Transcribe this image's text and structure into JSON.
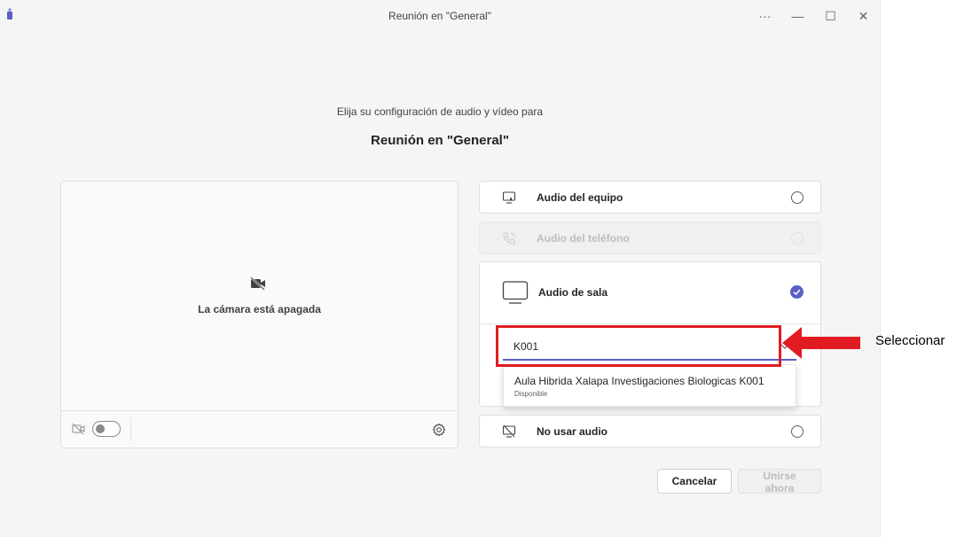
{
  "window": {
    "title": "Reunión en \"General\"",
    "more_label": "···",
    "minimize_label": "—",
    "maximize_label": "☐",
    "close_label": "✕"
  },
  "header": {
    "subtitle": "Elija su configuración de audio y vídeo para",
    "title": "Reunión en \"General\""
  },
  "video": {
    "camera_off_text": "La cámara está apagada",
    "camera_toggle_on": false
  },
  "audio_options": {
    "computer": {
      "label": "Audio del equipo",
      "selected": false
    },
    "phone": {
      "label": "Audio del teléfono",
      "disabled": true
    },
    "room": {
      "label": "Audio de sala",
      "selected": true,
      "search_value": "K001",
      "suggestion": {
        "name": "Aula Hibrida Xalapa Investigaciones Biologicas K001",
        "status": "Disponible"
      }
    },
    "none": {
      "label": "No usar audio",
      "selected": false
    }
  },
  "buttons": {
    "cancel": "Cancelar",
    "join": "Unirse ahora"
  },
  "annotation": {
    "label": "Seleccionar"
  },
  "colors": {
    "accent": "#5b5fc7",
    "annotation_red": "#e11b22"
  },
  "icons": {
    "app": "teams-icon",
    "camera_off": "camera-off-icon",
    "settings": "gear-icon",
    "computer_audio": "computer-speaker-icon",
    "phone_audio": "phone-icon",
    "room_audio": "room-display-icon",
    "checkmark": "checkmark-circle-icon",
    "no_audio": "speaker-off-icon",
    "chevron": "chevron-down-icon"
  }
}
